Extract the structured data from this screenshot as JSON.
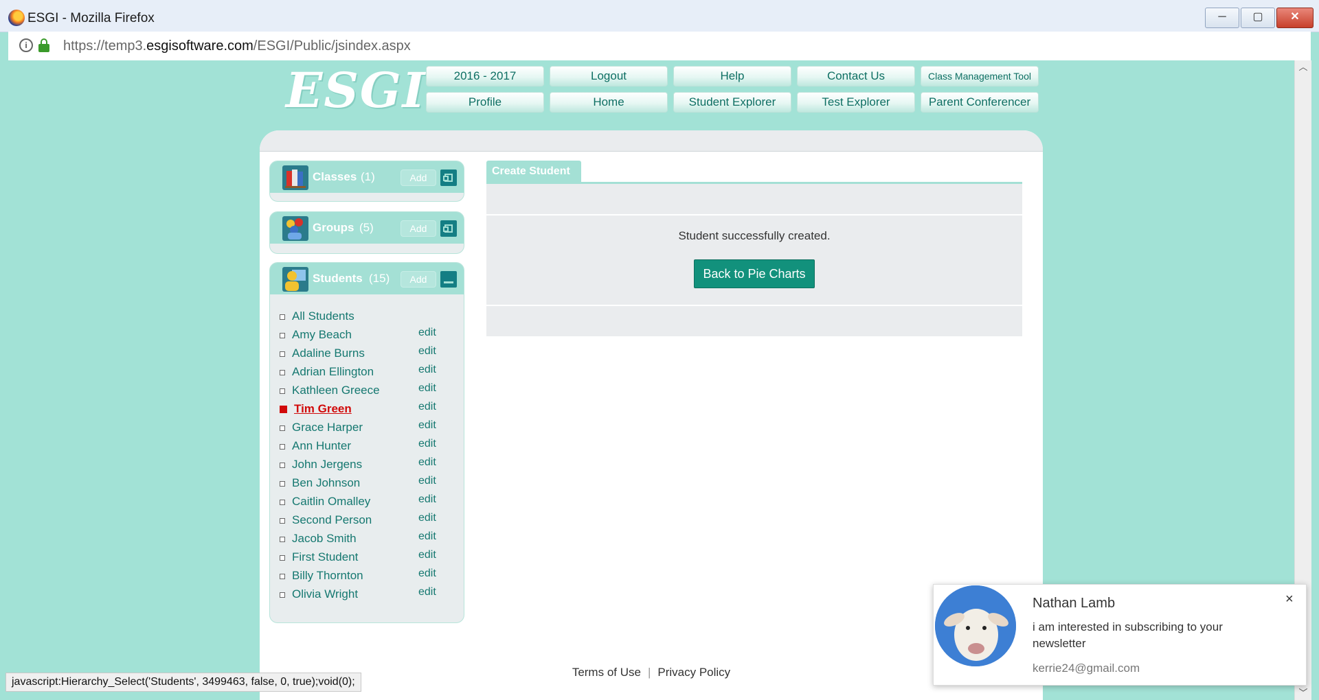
{
  "browser": {
    "window_title": "ESGI - Mozilla Firefox",
    "url_prefix": "https://temp3.",
    "url_domain": "esgisoftware.com",
    "url_path": "/ESGI/Public/jsindex.aspx",
    "status_text": "javascript:Hierarchy_Select('Students', 3499463, false, 0, true);void(0);",
    "controls": {
      "minimize": "─",
      "maximize": "▢",
      "close": "✕"
    }
  },
  "header": {
    "logo": "ESGI",
    "nav_row1": [
      "2016 - 2017",
      "Logout",
      "Help",
      "Contact Us",
      "Class Management Tool"
    ],
    "nav_row2": [
      "Profile",
      "Home",
      "Student Explorer",
      "Test Explorer",
      "Parent Conferencer"
    ]
  },
  "sidebar": {
    "classes": {
      "label": "Classes",
      "count": "(1)",
      "add_label": "Add"
    },
    "groups": {
      "label": "Groups",
      "count": "(5)",
      "add_label": "Add"
    },
    "students": {
      "label": "Students",
      "count": "(15)",
      "add_label": "Add"
    },
    "all_students": "All Students",
    "edit_label": "edit",
    "student_list": [
      "Amy Beach",
      "Adaline Burns",
      "Adrian Ellington",
      "Kathleen Greece",
      "Tim Green",
      "Grace Harper",
      "Ann Hunter",
      "John Jergens",
      "Ben Johnson",
      "Caitlin Omalley",
      "Second Person",
      "Jacob Smith",
      "First Student",
      "Billy Thornton",
      "Olivia Wright"
    ],
    "selected_student": "Tim Green"
  },
  "main": {
    "tab_label": "Create Student",
    "success_message": "Student successfully created.",
    "back_button": "Back to Pie Charts"
  },
  "footer": {
    "terms": "Terms of Use",
    "separator": "|",
    "privacy": "Privacy Policy"
  },
  "notification": {
    "name": "Nathan Lamb",
    "message": "i am interested in subscribing to your newsletter",
    "email": "kerrie24@gmail.com",
    "close": "×"
  },
  "colors": {
    "accent": "#a2e2d6",
    "link": "#157870",
    "selected": "#d10a0a",
    "button": "#12917c"
  }
}
